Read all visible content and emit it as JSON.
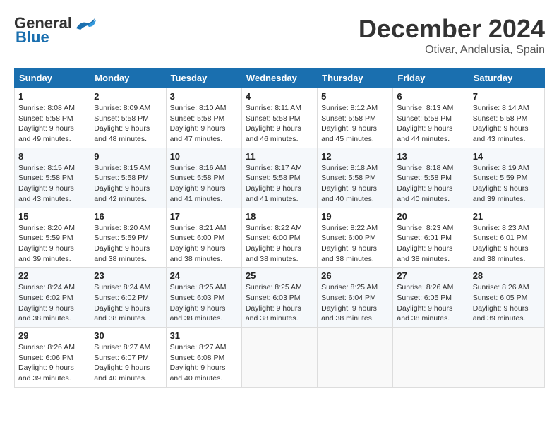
{
  "header": {
    "logo_general": "General",
    "logo_blue": "Blue",
    "month": "December 2024",
    "location": "Otivar, Andalusia, Spain"
  },
  "columns": [
    "Sunday",
    "Monday",
    "Tuesday",
    "Wednesday",
    "Thursday",
    "Friday",
    "Saturday"
  ],
  "weeks": [
    [
      {
        "day": "1",
        "info": "Sunrise: 8:08 AM\nSunset: 5:58 PM\nDaylight: 9 hours\nand 49 minutes."
      },
      {
        "day": "2",
        "info": "Sunrise: 8:09 AM\nSunset: 5:58 PM\nDaylight: 9 hours\nand 48 minutes."
      },
      {
        "day": "3",
        "info": "Sunrise: 8:10 AM\nSunset: 5:58 PM\nDaylight: 9 hours\nand 47 minutes."
      },
      {
        "day": "4",
        "info": "Sunrise: 8:11 AM\nSunset: 5:58 PM\nDaylight: 9 hours\nand 46 minutes."
      },
      {
        "day": "5",
        "info": "Sunrise: 8:12 AM\nSunset: 5:58 PM\nDaylight: 9 hours\nand 45 minutes."
      },
      {
        "day": "6",
        "info": "Sunrise: 8:13 AM\nSunset: 5:58 PM\nDaylight: 9 hours\nand 44 minutes."
      },
      {
        "day": "7",
        "info": "Sunrise: 8:14 AM\nSunset: 5:58 PM\nDaylight: 9 hours\nand 43 minutes."
      }
    ],
    [
      {
        "day": "8",
        "info": "Sunrise: 8:15 AM\nSunset: 5:58 PM\nDaylight: 9 hours\nand 43 minutes."
      },
      {
        "day": "9",
        "info": "Sunrise: 8:15 AM\nSunset: 5:58 PM\nDaylight: 9 hours\nand 42 minutes."
      },
      {
        "day": "10",
        "info": "Sunrise: 8:16 AM\nSunset: 5:58 PM\nDaylight: 9 hours\nand 41 minutes."
      },
      {
        "day": "11",
        "info": "Sunrise: 8:17 AM\nSunset: 5:58 PM\nDaylight: 9 hours\nand 41 minutes."
      },
      {
        "day": "12",
        "info": "Sunrise: 8:18 AM\nSunset: 5:58 PM\nDaylight: 9 hours\nand 40 minutes."
      },
      {
        "day": "13",
        "info": "Sunrise: 8:18 AM\nSunset: 5:58 PM\nDaylight: 9 hours\nand 40 minutes."
      },
      {
        "day": "14",
        "info": "Sunrise: 8:19 AM\nSunset: 5:59 PM\nDaylight: 9 hours\nand 39 minutes."
      }
    ],
    [
      {
        "day": "15",
        "info": "Sunrise: 8:20 AM\nSunset: 5:59 PM\nDaylight: 9 hours\nand 39 minutes."
      },
      {
        "day": "16",
        "info": "Sunrise: 8:20 AM\nSunset: 5:59 PM\nDaylight: 9 hours\nand 38 minutes."
      },
      {
        "day": "17",
        "info": "Sunrise: 8:21 AM\nSunset: 6:00 PM\nDaylight: 9 hours\nand 38 minutes."
      },
      {
        "day": "18",
        "info": "Sunrise: 8:22 AM\nSunset: 6:00 PM\nDaylight: 9 hours\nand 38 minutes."
      },
      {
        "day": "19",
        "info": "Sunrise: 8:22 AM\nSunset: 6:00 PM\nDaylight: 9 hours\nand 38 minutes."
      },
      {
        "day": "20",
        "info": "Sunrise: 8:23 AM\nSunset: 6:01 PM\nDaylight: 9 hours\nand 38 minutes."
      },
      {
        "day": "21",
        "info": "Sunrise: 8:23 AM\nSunset: 6:01 PM\nDaylight: 9 hours\nand 38 minutes."
      }
    ],
    [
      {
        "day": "22",
        "info": "Sunrise: 8:24 AM\nSunset: 6:02 PM\nDaylight: 9 hours\nand 38 minutes."
      },
      {
        "day": "23",
        "info": "Sunrise: 8:24 AM\nSunset: 6:02 PM\nDaylight: 9 hours\nand 38 minutes."
      },
      {
        "day": "24",
        "info": "Sunrise: 8:25 AM\nSunset: 6:03 PM\nDaylight: 9 hours\nand 38 minutes."
      },
      {
        "day": "25",
        "info": "Sunrise: 8:25 AM\nSunset: 6:03 PM\nDaylight: 9 hours\nand 38 minutes."
      },
      {
        "day": "26",
        "info": "Sunrise: 8:25 AM\nSunset: 6:04 PM\nDaylight: 9 hours\nand 38 minutes."
      },
      {
        "day": "27",
        "info": "Sunrise: 8:26 AM\nSunset: 6:05 PM\nDaylight: 9 hours\nand 38 minutes."
      },
      {
        "day": "28",
        "info": "Sunrise: 8:26 AM\nSunset: 6:05 PM\nDaylight: 9 hours\nand 39 minutes."
      }
    ],
    [
      {
        "day": "29",
        "info": "Sunrise: 8:26 AM\nSunset: 6:06 PM\nDaylight: 9 hours\nand 39 minutes."
      },
      {
        "day": "30",
        "info": "Sunrise: 8:27 AM\nSunset: 6:07 PM\nDaylight: 9 hours\nand 40 minutes."
      },
      {
        "day": "31",
        "info": "Sunrise: 8:27 AM\nSunset: 6:08 PM\nDaylight: 9 hours\nand 40 minutes."
      },
      null,
      null,
      null,
      null
    ]
  ]
}
